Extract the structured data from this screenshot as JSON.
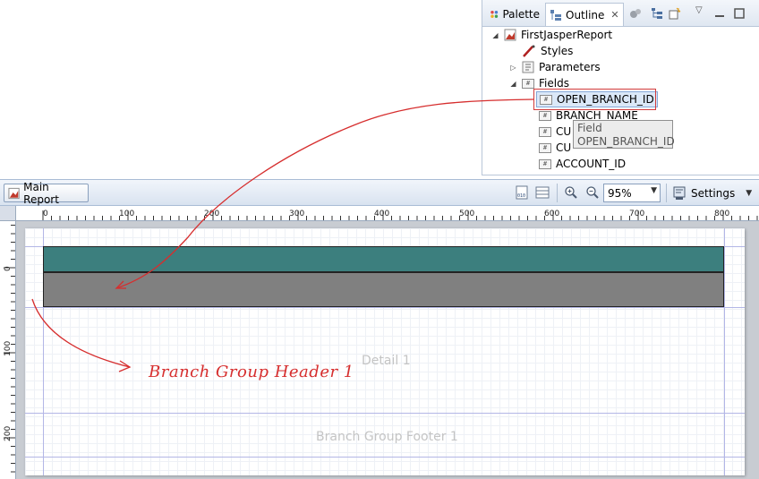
{
  "outline_view": {
    "tabs": [
      {
        "label": "Palette",
        "icon": "palette-icon"
      },
      {
        "label": "Outline",
        "icon": "outline-icon",
        "active": true
      }
    ],
    "tree": {
      "root": "FirstJasperReport",
      "styles": "Styles",
      "parameters": "Parameters",
      "fields": "Fields",
      "field_items": [
        "OPEN_BRANCH_ID",
        "BRANCH_NAME",
        "CU",
        "CU",
        "ACCOUNT_ID"
      ]
    },
    "tooltip": {
      "title": "Field",
      "value": "OPEN_BRANCH_ID"
    }
  },
  "editor": {
    "main_report_label": "Main Report",
    "zoom_value": "95%",
    "settings_label": "Settings",
    "h_ruler_ticks": [
      "0",
      "100",
      "200",
      "300",
      "400",
      "500",
      "600",
      "700",
      "800"
    ],
    "v_ruler_ticks": [
      "0",
      "100",
      "200"
    ],
    "bands": {
      "detail": "Detail 1",
      "group_footer": "Branch Group Footer 1"
    },
    "colors": {
      "teal_field": "#3c7f7e",
      "gray_field": "#808080",
      "annotation": "#d62e2e"
    }
  },
  "annotation": {
    "text": "Branch Group Header 1"
  }
}
